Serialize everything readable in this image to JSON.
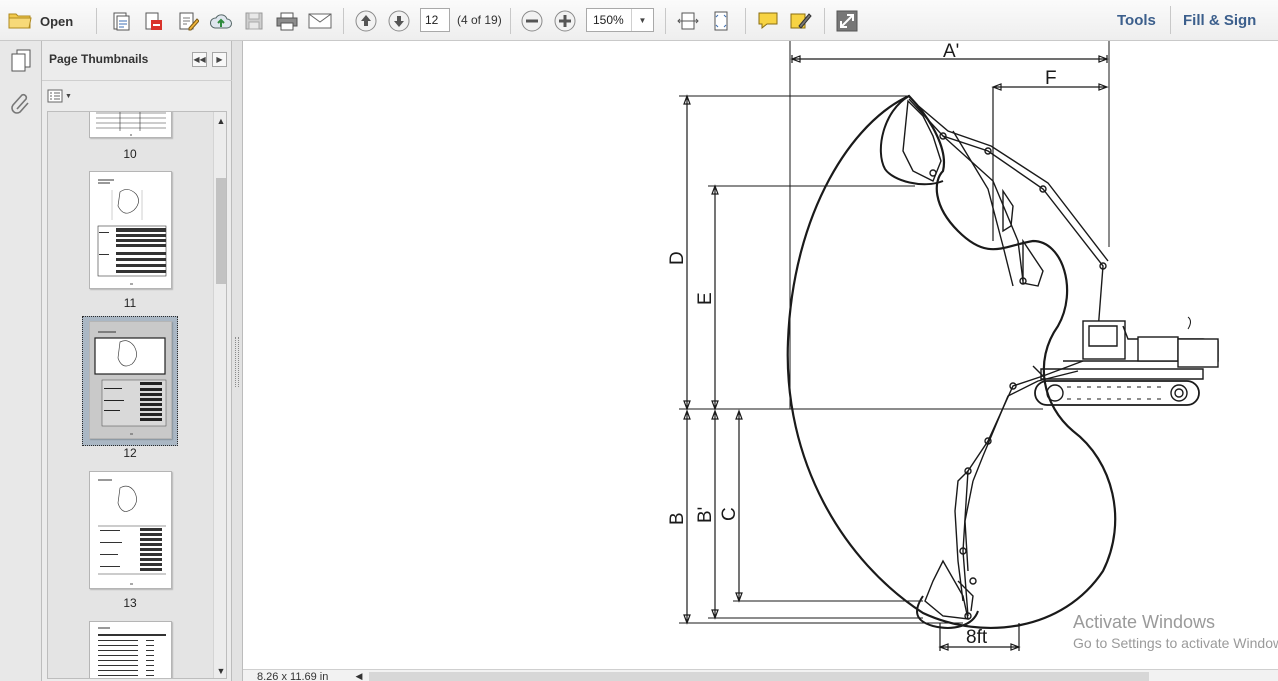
{
  "toolbar": {
    "open_label": "Open",
    "page_number": "12",
    "page_count": "(4 of 19)",
    "zoom": "150%",
    "tools_label": "Tools",
    "fill_sign_label": "Fill & Sign"
  },
  "thumbnail_panel": {
    "title": "Page Thumbnails",
    "thumbnails": [
      {
        "label": "10"
      },
      {
        "label": "11"
      },
      {
        "label": "12"
      },
      {
        "label": "13"
      }
    ]
  },
  "document": {
    "dimension_labels": {
      "a_prime": "A'",
      "f": "F",
      "d": "D",
      "e": "E",
      "b": "B",
      "b_prime": "B'",
      "c": "C",
      "eight_ft": "8ft"
    }
  },
  "status": {
    "page_size": "8.26 x 11.69 in"
  },
  "watermark": {
    "title": "Activate Windows",
    "subtitle": "Go to Settings to activate Windows."
  },
  "colors": {
    "link": "#3c5f8c",
    "selection": "#aab7c4"
  }
}
